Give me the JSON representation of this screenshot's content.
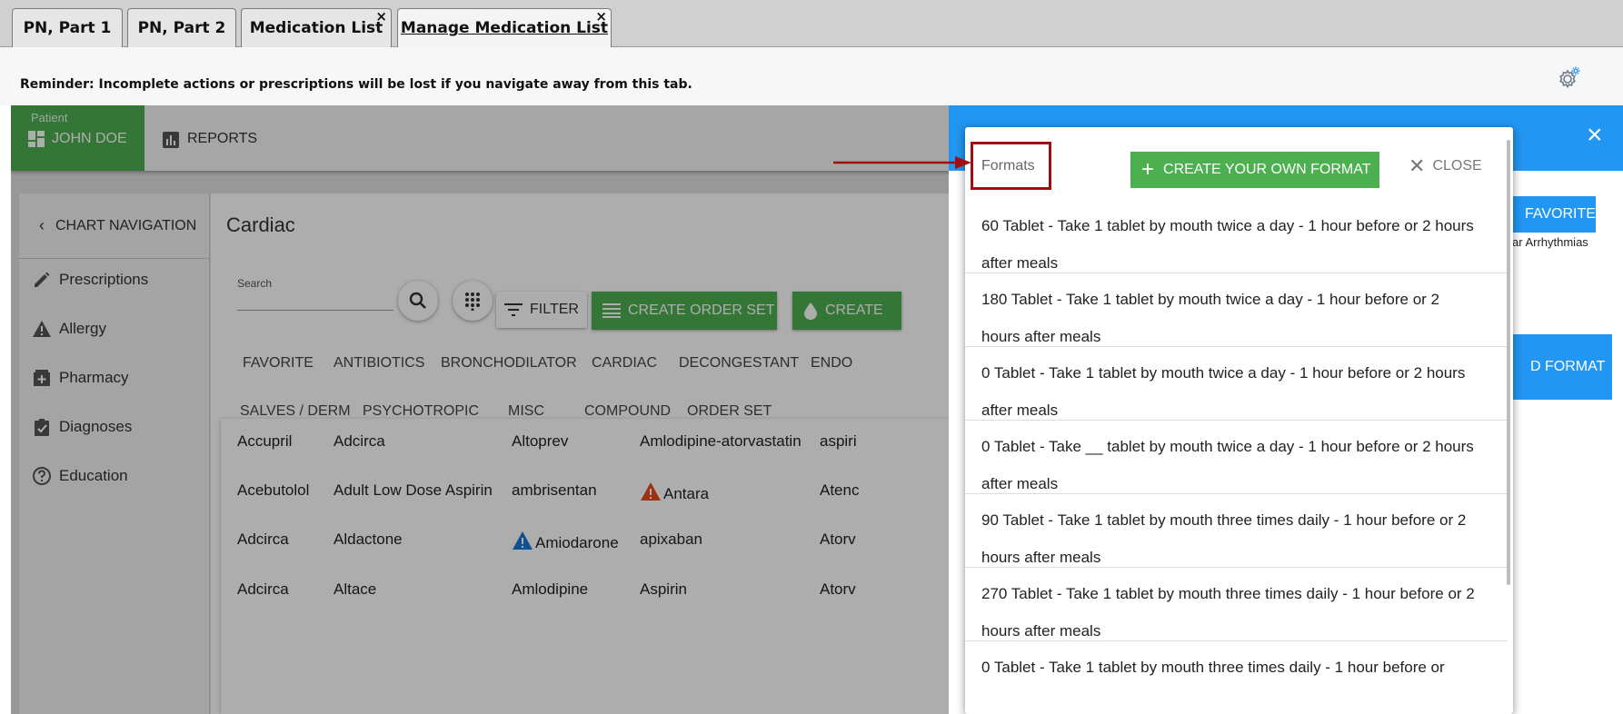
{
  "tabs": [
    {
      "label": "PN, Part 1",
      "closable": false
    },
    {
      "label": "PN, Part 2",
      "closable": false
    },
    {
      "label": "Medication List",
      "closable": true
    },
    {
      "label": "Manage Medication List",
      "closable": true,
      "active": true
    }
  ],
  "close_glyph": "×",
  "reminder": "Reminder: Incomplete actions or prescriptions will be lost if you navigate away from this tab.",
  "header": {
    "patient_label": "Patient",
    "patient_name": "JOHN DOE",
    "reports": "REPORTS"
  },
  "sidebar": {
    "chart_nav": "CHART NAVIGATION",
    "items": [
      {
        "label": "Prescriptions",
        "icon": "pencil-icon"
      },
      {
        "label": "Allergy",
        "icon": "warning-icon"
      },
      {
        "label": "Pharmacy",
        "icon": "pharmacy-icon"
      },
      {
        "label": "Diagnoses",
        "icon": "clipboard-icon"
      },
      {
        "label": "Education",
        "icon": "help-circle-icon"
      }
    ]
  },
  "main": {
    "title": "Cardiac",
    "search_label": "Search",
    "filter": "FILTER",
    "create_order_set": "CREATE ORDER SET",
    "create_partial": "CREATE",
    "categories_row1": [
      "FAVORITE",
      "ANTIBIOTICS",
      "BRONCHODILATOR",
      "CARDIAC",
      "DECONGESTANT",
      "ENDO"
    ],
    "categories_row2": [
      "SALVES / DERM",
      "PSYCHOTROPIC",
      "MISC",
      "COMPOUND",
      "ORDER SET"
    ],
    "meds": [
      [
        "Accupril",
        "Adcirca",
        "Altoprev",
        "Amlodipine-atorvastatin",
        "aspiri"
      ],
      [
        "Acebutolol",
        "Adult Low Dose Aspirin",
        "ambrisentan",
        "Antara",
        "Atenc"
      ],
      [
        "Adcirca",
        "Aldactone",
        "Amiodarone",
        "apixaban",
        "Atorv"
      ],
      [
        "Adcirca",
        "Altace",
        "Amlodipine",
        "Aspirin",
        "Atorv"
      ]
    ]
  },
  "drawer": {
    "favorite_btn": "FAVORITE",
    "note": "ar Arrhythmias",
    "format_btn": "D FORMAT"
  },
  "dialog": {
    "formats_label": "Formats",
    "create_btn": "CREATE YOUR OWN FORMAT",
    "close_btn": "CLOSE",
    "formats": [
      "60 Tablet - Take 1 tablet by mouth twice a day - 1 hour before or 2 hours after meals",
      "180 Tablet - Take 1 tablet by mouth twice a day - 1 hour before or 2 hours after meals",
      "0 Tablet - Take 1 tablet by mouth twice a day - 1 hour before or 2 hours after meals",
      "0 Tablet - Take __ tablet by mouth twice a day - 1 hour before or 2 hours after meals",
      "90 Tablet - Take 1 tablet by mouth three times daily - 1 hour before or 2 hours after meals",
      "270 Tablet - Take 1 tablet by mouth three times daily - 1 hour before or 2 hours after meals",
      "0 Tablet - Take 1 tablet by mouth three times daily - 1 hour before or"
    ]
  },
  "colors": {
    "green": "#4caf50",
    "blue": "#2196f3",
    "highlight_red": "#a00d13",
    "warning_orange": "#e64a19",
    "warning_blue": "#1976d2"
  }
}
